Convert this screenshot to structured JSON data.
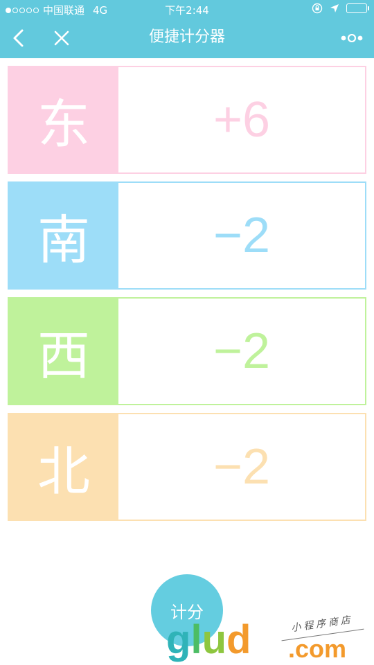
{
  "status_bar": {
    "carrier": "中国联通",
    "network": "4G",
    "time": "下午2:44"
  },
  "nav": {
    "title": "便捷计分器"
  },
  "scores": [
    {
      "direction": "东",
      "score": "+6",
      "color": "#fdd0e3"
    },
    {
      "direction": "南",
      "score": "−2",
      "color": "#9dddf8"
    },
    {
      "direction": "西",
      "score": "−2",
      "color": "#bff29b"
    },
    {
      "direction": "北",
      "score": "−2",
      "color": "#fce0b1"
    }
  ],
  "count_button": {
    "label": "计分"
  },
  "watermark": {
    "brand": "glud",
    "domain": ".com",
    "tagline": "小程序商店"
  },
  "colors": {
    "header": "#62c9dd",
    "button": "#64cde0"
  }
}
